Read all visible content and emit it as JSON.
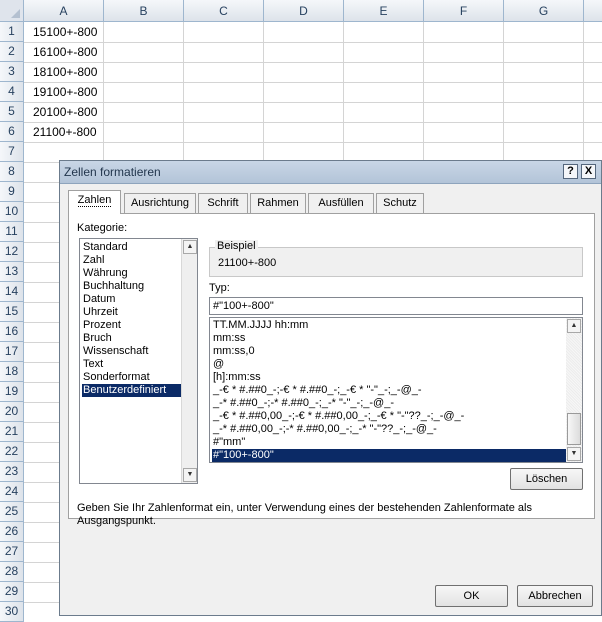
{
  "sheet": {
    "columns": [
      "A",
      "B",
      "C",
      "D",
      "E",
      "F",
      "G"
    ],
    "rows": [
      "1",
      "2",
      "3",
      "4",
      "5",
      "6",
      "7",
      "8",
      "9",
      "10",
      "11",
      "12",
      "13",
      "14",
      "15",
      "16",
      "17",
      "18",
      "19",
      "20",
      "21",
      "22",
      "23",
      "24",
      "25",
      "26",
      "27",
      "28",
      "29",
      "30"
    ],
    "cells_a": [
      "15100+-800",
      "16100+-800",
      "18100+-800",
      "19100+-800",
      "20100+-800",
      "21100+-800"
    ]
  },
  "dialog": {
    "title": "Zellen formatieren",
    "help_button": "?",
    "close_button": "X",
    "tabs": [
      "Zahlen",
      "Ausrichtung",
      "Schrift",
      "Rahmen",
      "Ausfüllen",
      "Schutz"
    ],
    "active_tab": "Zahlen",
    "category_label": "Kategorie:",
    "categories": [
      "Standard",
      "Zahl",
      "Währung",
      "Buchhaltung",
      "Datum",
      "Uhrzeit",
      "Prozent",
      "Bruch",
      "Wissenschaft",
      "Text",
      "Sonderformat",
      "Benutzerdefiniert"
    ],
    "selected_category": "Benutzerdefiniert",
    "sample_label": "Beispiel",
    "sample_value": "21100+-800",
    "type_label": "Typ:",
    "type_value": "#\"100+-800\"",
    "formats": [
      "TT.MM.JJJJ hh:mm",
      "mm:ss",
      "mm:ss,0",
      "@",
      "[h]:mm:ss",
      "_-€ * #.##0_-;-€ * #.##0_-;_-€ * \"-\"_-;_-@_-",
      "_-* #.##0_-;-* #.##0_-;_-* \"-\"_-;_-@_-",
      "_-€ * #.##0,00_-;-€ * #.##0,00_-;_-€ * \"-\"??_-;_-@_-",
      "_-* #.##0,00_-;-* #.##0,00_-;_-* \"-\"??_-;_-@_-",
      "#\"mm\"",
      "#\"100+-800\""
    ],
    "selected_format": "#\"100+-800\"",
    "delete_button": "Löschen",
    "description": "Geben Sie Ihr Zahlenformat ein, unter Verwendung eines der bestehenden Zahlenformate als Ausgangspunkt.",
    "ok_button": "OK",
    "cancel_button": "Abbrechen"
  },
  "colors": {
    "selection": "#0b2a66",
    "grid": "#d4d4d4",
    "header_text": "#27415f"
  }
}
